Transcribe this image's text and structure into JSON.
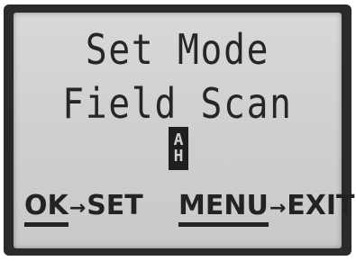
{
  "screen": {
    "title": "Set Mode",
    "mode_label": "Field Scan",
    "cursor_chars": [
      "A",
      "H"
    ]
  },
  "softkeys": {
    "ok": {
      "key": "OK",
      "arrow": "→",
      "action": "SET"
    },
    "menu": {
      "key": "MENU",
      "arrow": "→",
      "action": "EXIT"
    }
  },
  "colors": {
    "lcd_background": "#d0d0ce",
    "lcd_text": "#262626",
    "bezel": "#2a2a2a"
  }
}
